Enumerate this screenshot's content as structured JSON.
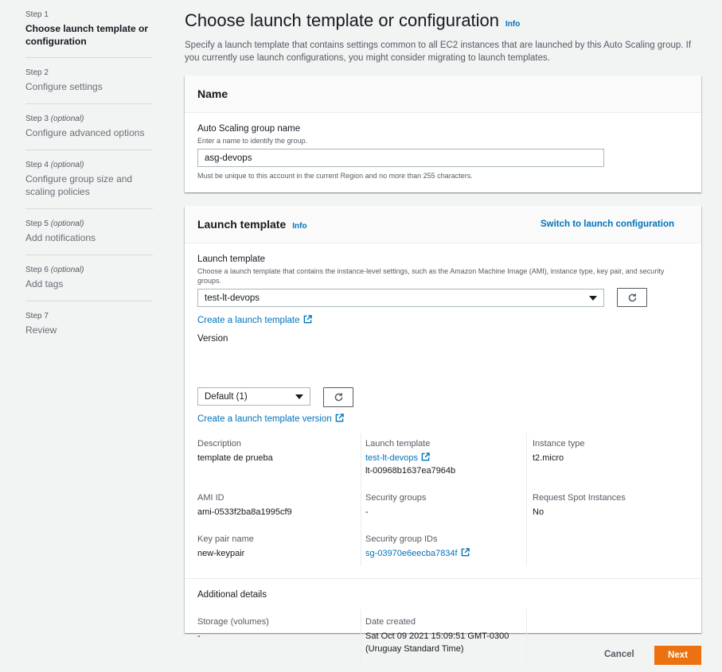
{
  "sidebar": {
    "steps": [
      {
        "num": "Step 1",
        "optional": "",
        "title": "Choose launch template or configuration",
        "active": true
      },
      {
        "num": "Step 2",
        "optional": "",
        "title": "Configure settings"
      },
      {
        "num": "Step 3",
        "optional": "(optional)",
        "title": "Configure advanced options"
      },
      {
        "num": "Step 4",
        "optional": "(optional)",
        "title": "Configure group size and scaling policies"
      },
      {
        "num": "Step 5",
        "optional": "(optional)",
        "title": "Add notifications"
      },
      {
        "num": "Step 6",
        "optional": "(optional)",
        "title": "Add tags"
      },
      {
        "num": "Step 7",
        "optional": "",
        "title": "Review"
      }
    ]
  },
  "header": {
    "title": "Choose launch template or configuration",
    "info": "Info",
    "description": "Specify a launch template that contains settings common to all EC2 instances that are launched by this Auto Scaling group. If you currently use launch configurations, you might consider migrating to launch templates."
  },
  "name_panel": {
    "title": "Name",
    "field_label": "Auto Scaling group name",
    "field_hint": "Enter a name to identify the group.",
    "field_value": "asg-devops",
    "constraint": "Must be unique to this account in the current Region and no more than 255 characters."
  },
  "lt_panel": {
    "title": "Launch template",
    "info": "Info",
    "switch_link": "Switch to launch configuration",
    "template_label": "Launch template",
    "template_hint": "Choose a launch template that contains the instance-level settings, such as the Amazon Machine Image (AMI), instance type, key pair, and security groups.",
    "template_value": "test-lt-devops",
    "create_template_link": "Create a launch template",
    "version_label": "Version",
    "version_value": "Default (1)",
    "create_version_link": "Create a launch template version",
    "details": {
      "description_label": "Description",
      "description_value": "template de prueba",
      "lt_label": "Launch template",
      "lt_link": "test-lt-devops",
      "lt_id": "lt-00968b1637ea7964b",
      "instance_type_label": "Instance type",
      "instance_type_value": "t2.micro",
      "ami_label": "AMI ID",
      "ami_value": "ami-0533f2ba8a1995cf9",
      "sg_label": "Security groups",
      "sg_value": "-",
      "spot_label": "Request Spot Instances",
      "spot_value": "No",
      "keypair_label": "Key pair name",
      "keypair_value": "new-keypair",
      "sgid_label": "Security group IDs",
      "sgid_link": "sg-03970e6eecba7834f"
    },
    "additional": {
      "title": "Additional details",
      "storage_label": "Storage (volumes)",
      "storage_value": "-",
      "date_label": "Date created",
      "date_value_line1": "Sat Oct 09 2021 15:09:51 GMT-0300",
      "date_value_line2": "(Uruguay Standard Time)"
    }
  },
  "footer": {
    "cancel": "Cancel",
    "next": "Next"
  },
  "colors": {
    "accent": "#0073bb",
    "primary_button": "#ec7211",
    "background": "#f2f3f3"
  }
}
